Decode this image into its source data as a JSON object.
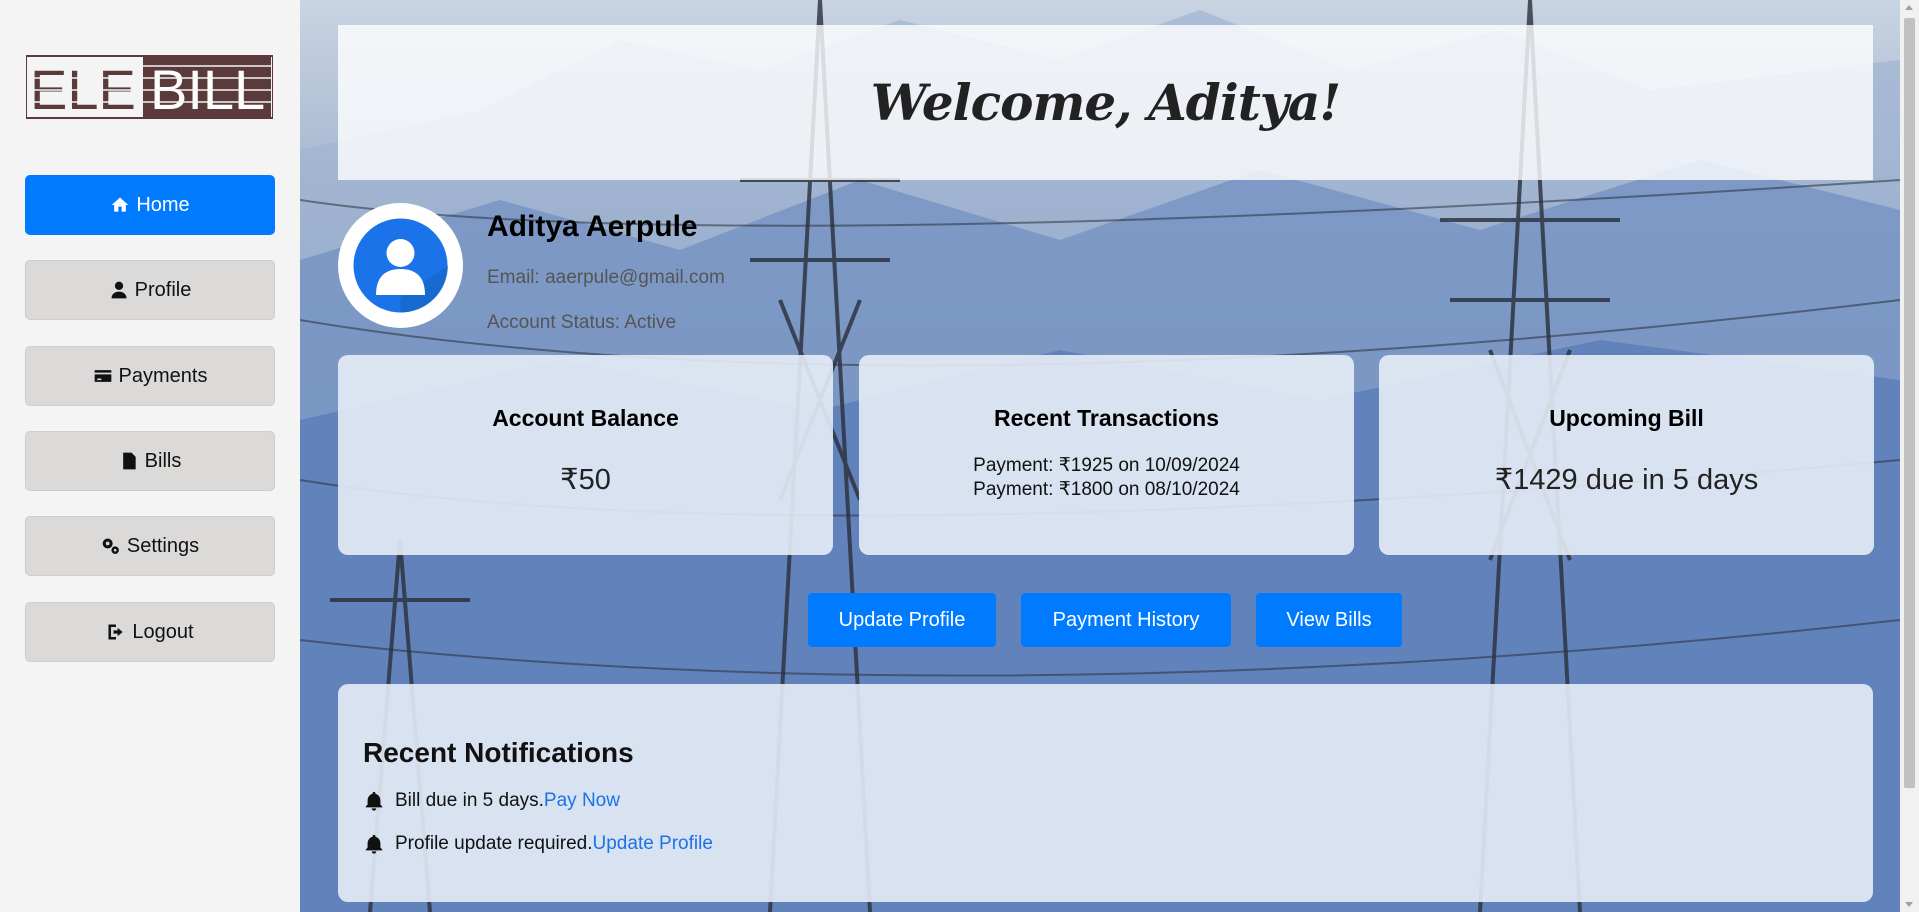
{
  "logo": {
    "text_left": "ELE",
    "text_right": "BILL"
  },
  "sidebar": {
    "items": [
      {
        "label": "Home",
        "icon": "home-icon",
        "active": true
      },
      {
        "label": "Profile",
        "icon": "user-icon",
        "active": false
      },
      {
        "label": "Payments",
        "icon": "credit-card-icon",
        "active": false
      },
      {
        "label": "Bills",
        "icon": "document-icon",
        "active": false
      },
      {
        "label": "Settings",
        "icon": "cogs-icon",
        "active": false
      },
      {
        "label": "Logout",
        "icon": "sign-out-icon",
        "active": false
      }
    ]
  },
  "welcome": {
    "text": "Welcome, Aditya!"
  },
  "profile": {
    "name": "Aditya Aerpule",
    "email": "Email: aaerpule@gmail.com",
    "status": "Account Status: Active"
  },
  "cards": [
    {
      "title": "Account Balance",
      "value": "₹50"
    },
    {
      "title": "Recent Transactions",
      "lines": [
        "Payment: ₹1925 on 10/09/2024",
        "Payment: ₹1800 on 08/10/2024"
      ]
    },
    {
      "title": "Upcoming Bill",
      "value": "₹1429 due in 5 days"
    }
  ],
  "actions": [
    "Update Profile",
    "Payment History",
    "View Bills"
  ],
  "notifications": {
    "title": "Recent Notifications",
    "items": [
      {
        "text": "Bill due in 5 days.",
        "link": "Pay Now"
      },
      {
        "text": "Profile update required.",
        "link": "Update Profile"
      }
    ]
  },
  "colors": {
    "accent": "#007bff",
    "sidebar_bg": "#f4f4f4",
    "nav_inactive": "#dcdad9",
    "logo": "#5a3a3a",
    "link": "#1a73e8"
  }
}
